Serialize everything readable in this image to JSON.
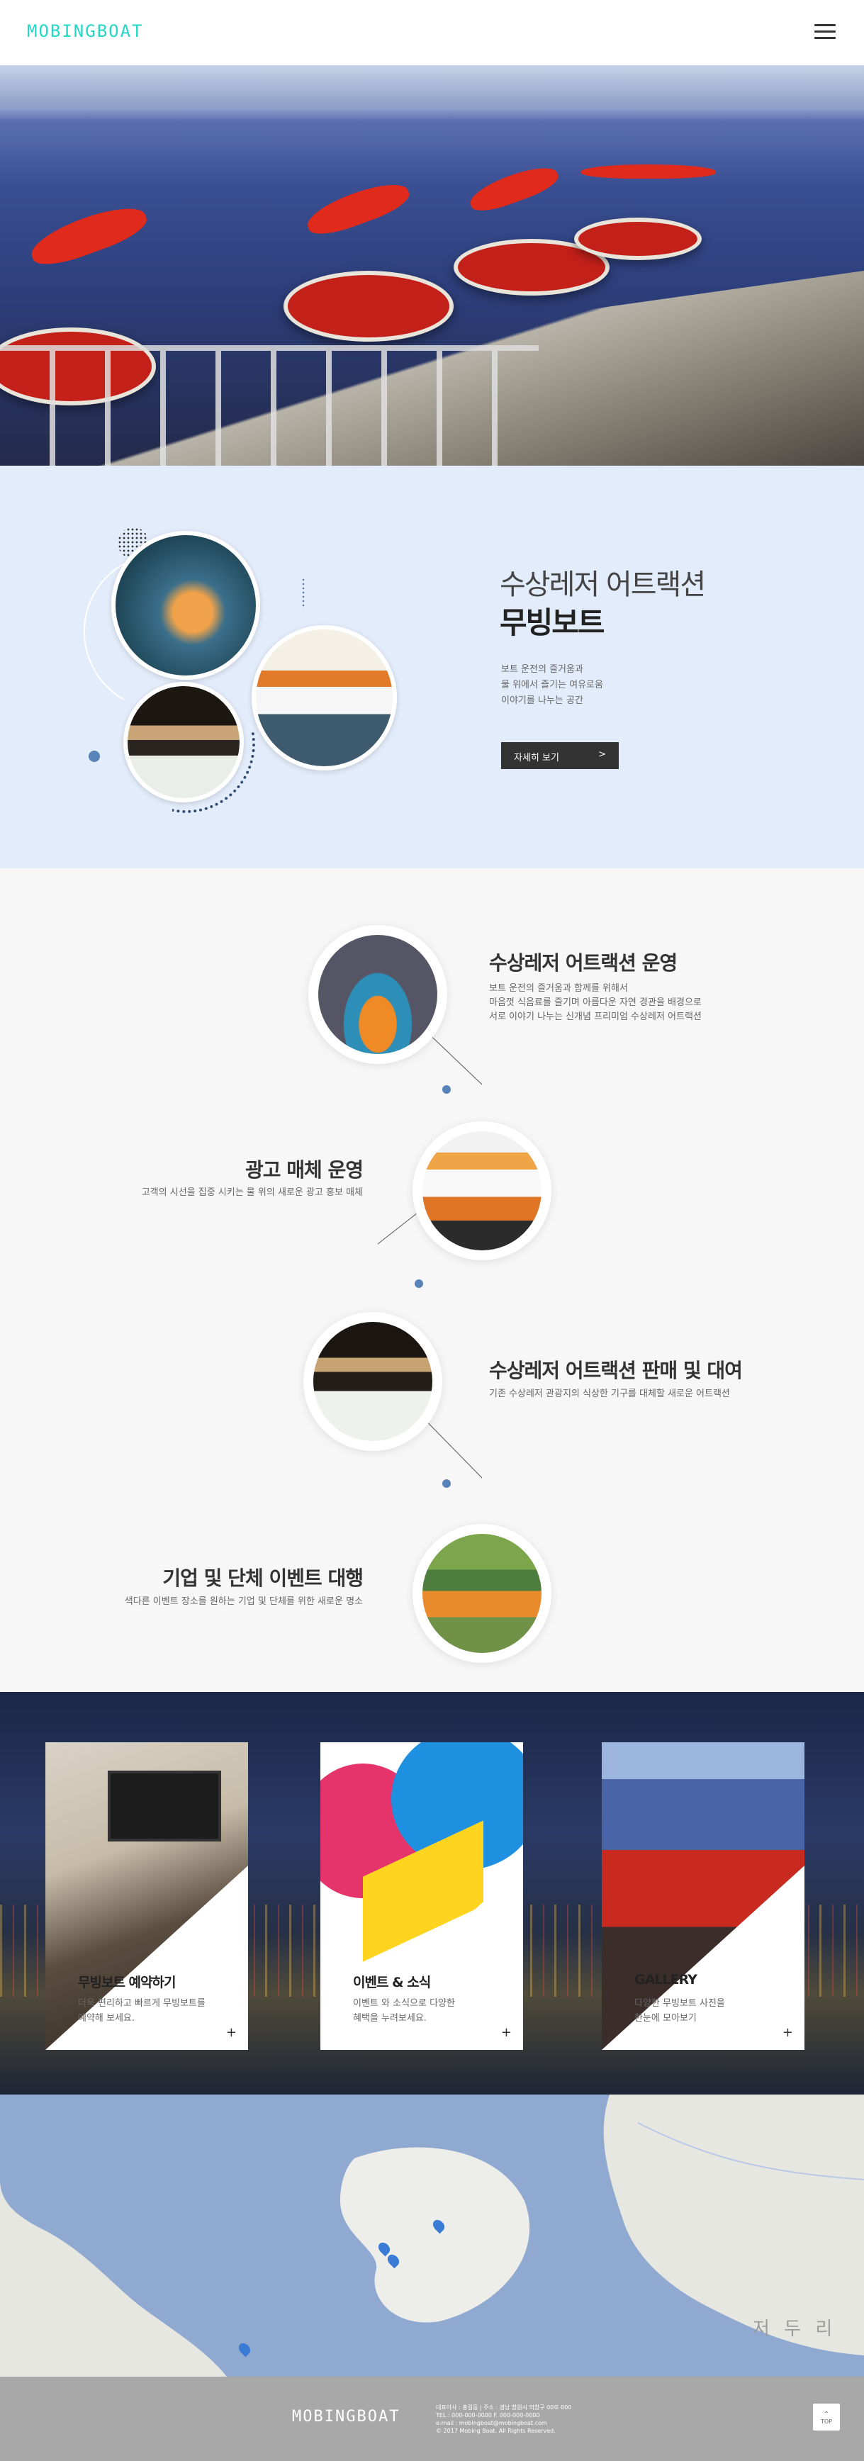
{
  "header": {
    "logo": "MOBINGBOAT"
  },
  "about": {
    "subtitle": "수상레저 어트랙션",
    "title": "무빙보트",
    "desc": [
      "보트 운전의 즐거움과",
      "물 위에서 즐기는 여유로움",
      "이야기를 나누는 공간"
    ],
    "button": "자세히 보기",
    "button_arrow": ">"
  },
  "services": [
    {
      "title": "수상레저 어트랙션 운영",
      "desc": [
        "보트 운전의 즐거움과 함께를 위해서",
        "마음껏 식음료를 즐기며 아름다운 자연 경관을 배경으로",
        "서로 이야기 나누는 신개념 프리미엄 수상레저 어트랙션"
      ]
    },
    {
      "title": "광고 매체 운영",
      "desc": [
        "고객의 시선을 집중 시키는 물 위의 새로운 광고 홍보 매체"
      ]
    },
    {
      "title": "수상레저 어트랙션 판매 및 대여",
      "desc": [
        "기존 수상레저 관광지의 식상한 기구를 대체할 새로운 어트랙션"
      ]
    },
    {
      "title": "기업 및 단체 이벤트 대행",
      "desc": [
        "색다른 이벤트 장소를 원하는 기업 및 단체를 위한 새로운 명소"
      ]
    }
  ],
  "cards": [
    {
      "title": "무빙보트 예약하기",
      "desc": [
        "더욱 편리하고 빠르게 무빙보트를",
        "예약해 보세요."
      ],
      "plus": "+"
    },
    {
      "title": "이벤트 & 소식",
      "desc": [
        "이벤트 와 소식으로 다양한",
        "혜택을 누려보세요."
      ],
      "plus": "+"
    },
    {
      "title": "GALLERY",
      "desc": [
        "다양한 무빙보트 사진을",
        "한눈에 모아보기"
      ],
      "plus": "+"
    }
  ],
  "map": {
    "label": "저 두 리"
  },
  "footer": {
    "logo": "MOBINGBOAT",
    "info": [
      "대표이사 : 홍길동   |   주소 : 경남 창원시 의창구 00로 000",
      "TEL : 000-000-0000  F. 000-000-0000",
      "e-mail : mobingboat@mobingboat.com",
      "© 2017 Mobing Boat. All Rights Reserved."
    ],
    "top": "TOP"
  },
  "colors": {
    "accent": "#23d7c7",
    "about_bg": "#e3ecfa",
    "highlight": "#7ff0dc",
    "dot": "#5783b8"
  }
}
